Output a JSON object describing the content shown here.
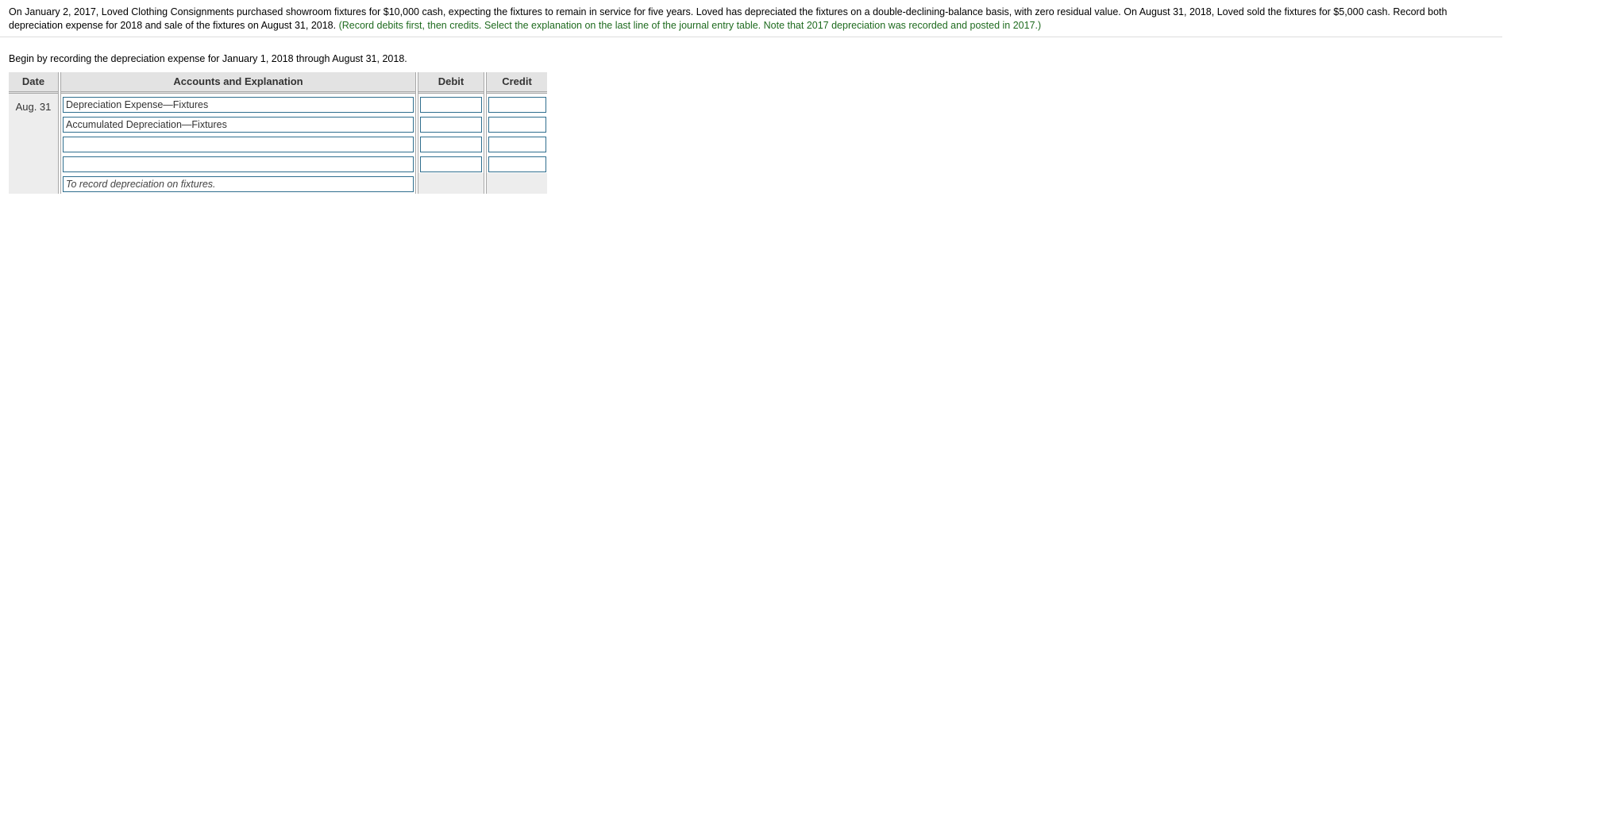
{
  "problem": {
    "line1": "On January 2, 2017, Loved Clothing Consignments purchased showroom fixtures for $10,000 cash, expecting the fixtures to remain in service for five years. Loved has depreciated the fixtures on a double-declining-balance basis, with zero residual value. On August 31, 2018, Loved sold the fixtures for $5,000 cash. Record both",
    "line2": "depreciation expense for 2018 and sale of the fixtures on August 31, 2018.",
    "note": "(Record debits first, then credits. Select the explanation on the last line of the journal entry table. Note that 2017 depreciation was recorded and posted in 2017.)"
  },
  "instruction": "Begin by recording the depreciation expense for January 1, 2018 through August 31, 2018.",
  "journal": {
    "headers": {
      "date": "Date",
      "accounts": "Accounts and Explanation",
      "debit": "Debit",
      "credit": "Credit"
    },
    "date": "Aug. 31",
    "rows": [
      {
        "account": "Depreciation Expense—Fixtures",
        "debit": "",
        "credit": ""
      },
      {
        "account": "Accumulated Depreciation—Fixtures",
        "debit": "",
        "credit": ""
      },
      {
        "account": "",
        "debit": "",
        "credit": ""
      },
      {
        "account": "",
        "debit": "",
        "credit": ""
      }
    ],
    "explanation": "To record depreciation on fixtures."
  },
  "colors": {
    "field_border": "#2f6e8e",
    "header_bg": "#e3e3e3",
    "note_green": "#1f6b1f"
  }
}
